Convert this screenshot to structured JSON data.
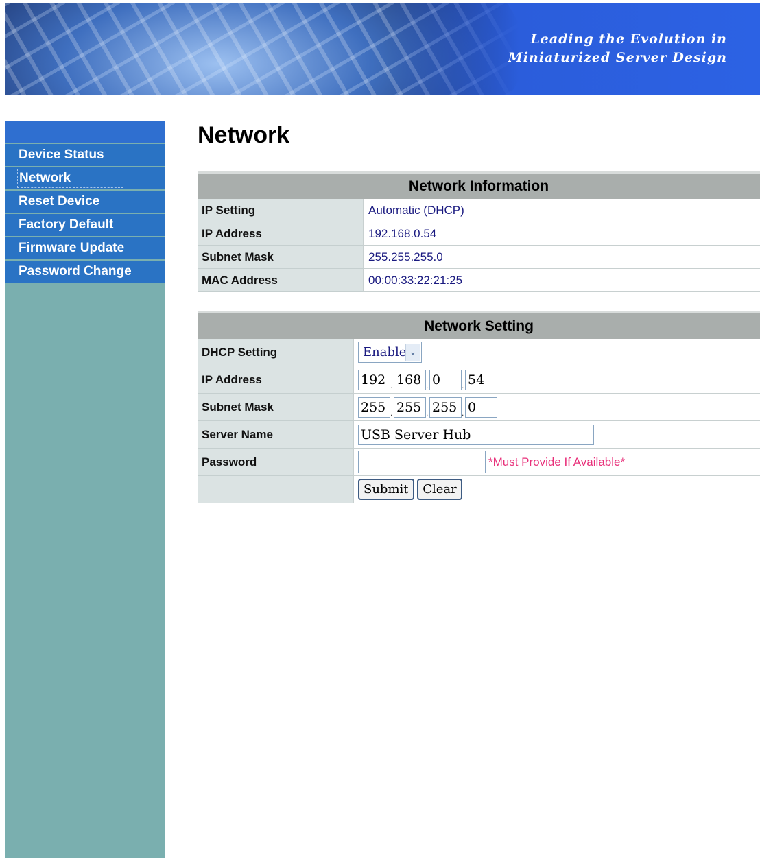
{
  "banner": {
    "slogan_line1": "Leading the Evolution in",
    "slogan_line2": "Miniaturized Server Design"
  },
  "sidebar": {
    "active": "Network",
    "items": [
      {
        "label": "Device Status"
      },
      {
        "label": "Network"
      },
      {
        "label": "Reset Device"
      },
      {
        "label": "Factory Default"
      },
      {
        "label": "Firmware Update"
      },
      {
        "label": "Password Change"
      }
    ]
  },
  "page": {
    "title": "Network"
  },
  "network_info": {
    "header": "Network Information",
    "rows": [
      {
        "label": "IP Setting",
        "value": "Automatic (DHCP)"
      },
      {
        "label": "IP Address",
        "value": "192.168.0.54"
      },
      {
        "label": "Subnet Mask",
        "value": "255.255.255.0"
      },
      {
        "label": "MAC Address",
        "value": "00:00:33:22:21:25"
      }
    ]
  },
  "network_setting": {
    "header": "Network Setting",
    "dhcp": {
      "label": "DHCP Setting",
      "selected": "Enable"
    },
    "ip": {
      "label": "IP Address",
      "octets": [
        "192",
        "168",
        "0",
        "54"
      ]
    },
    "mask": {
      "label": "Subnet Mask",
      "octets": [
        "255",
        "255",
        "255",
        "0"
      ]
    },
    "server_name": {
      "label": "Server Name",
      "value": "USB Server Hub"
    },
    "password": {
      "label": "Password",
      "value": "",
      "note": "*Must Provide If Available*"
    },
    "buttons": {
      "submit": "Submit",
      "clear": "Clear"
    }
  },
  "colors": {
    "nav_bg": "#2a73c4",
    "sidebar_bg": "#7aafaf",
    "header_bg": "#a9aeac",
    "label_bg": "#dbe3e3",
    "warning": "#e8307a"
  }
}
